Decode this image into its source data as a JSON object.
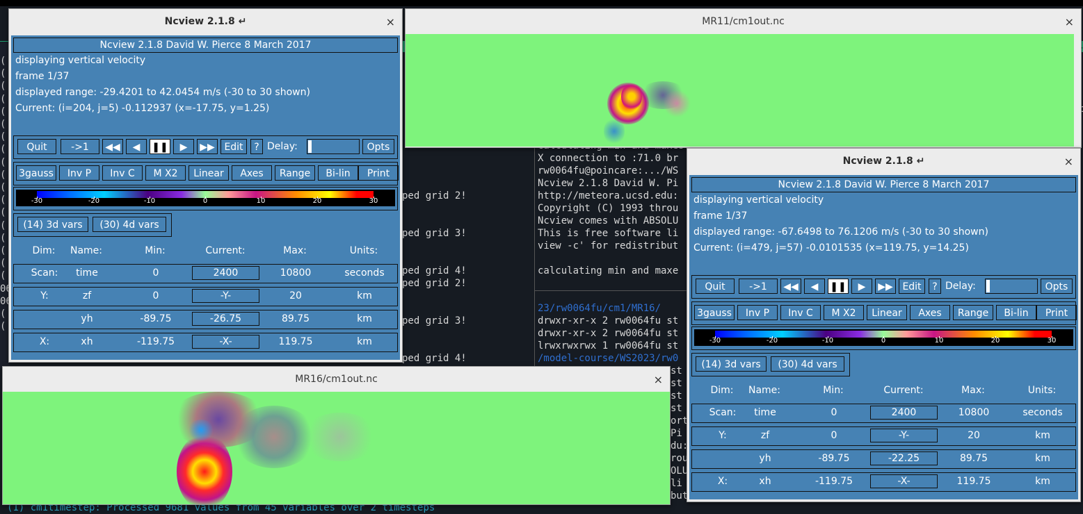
{
  "colorbar_ticks": [
    "-30",
    "-20",
    "-10",
    "0",
    "10",
    "20",
    "30"
  ],
  "terminal": {
    "left_lines": [
      {
        "text": "ped grid 2!"
      },
      {
        "text": "ped grid 3!"
      },
      {
        "text": "ped grid 4!"
      },
      {
        "text": "ped grid 2!"
      },
      {
        "text": "ped grid 3!"
      },
      {
        "text": "ped grid 4!"
      }
    ],
    "middle_top_lines": [
      "calculating min and maxes for w...",
      "X connection to :71.0 br",
      "rw0064fu@poincare:.../WS",
      "Ncview 2.1.8 David W. Pi",
      "http://meteora.ucsd.edu:",
      "Copyright (C) 1993 throu",
      "Ncview comes with ABSOLU",
      "This is free software li",
      "view -c' for redistribut",
      "",
      "calculating min and maxe"
    ],
    "middle_mid_lines": [
      "23/rw0064fu/cm1/MR16/",
      "drwxr-xr-x 2 rw0064fu st",
      "drwxr-xr-x 2 rw0064fu st",
      "lrwxrwxrwx 1 rw0064fu st",
      "/model-course/WS2023/rw0"
    ],
    "middle_bottom_lines": [
      "st",
      "st",
      "st",
      "st",
      "ort",
      "Pi",
      "du:",
      "rou",
      "OLU",
      "li",
      "but"
    ],
    "bottom_line": "(1) cm1timestep: Processed 9681 values from 45 variables over 2 timesteps",
    "left_edge_chars": [
      "(",
      "(",
      "(",
      "(",
      "(",
      "(",
      "(",
      "(",
      "(",
      "(",
      "(",
      "(",
      "(",
      "(",
      "(",
      "(",
      "(",
      "(",
      "06",
      "06",
      "(",
      "("
    ],
    "right_edge_chars": [
      "nc",
      "24"
    ]
  },
  "windows": [
    {
      "title": "Ncview 2.1.8 ↵",
      "close": "×",
      "header": "Ncview 2.1.8 David W. Pierce  8 March 2017",
      "info": [
        "displaying vertical velocity",
        "frame 1/37",
        "displayed range: -29.4201 to 42.0454 m/s (-30 to 30 shown)",
        "Current: (i=204, j=5) -0.112937 (x=-17.75, y=1.25)"
      ],
      "buttons1": [
        "Quit",
        "->1",
        "◀◀",
        "◀",
        "❚❚",
        "▶",
        "▶▶",
        "Edit",
        "?"
      ],
      "delay_label": "Delay:",
      "opts": "Opts",
      "buttons2": [
        "3gauss",
        "Inv P",
        "Inv C",
        "M X2",
        "Linear",
        "Axes",
        "Range",
        "Bi-lin",
        "Print"
      ],
      "vars": [
        "(14) 3d vars",
        "(30) 4d vars"
      ],
      "dim_header": [
        "Dim:",
        "Name:",
        "Min:",
        "Current:",
        "Max:",
        "Units:"
      ],
      "dims": [
        {
          "dim": "Scan:",
          "name": "time",
          "min": "0",
          "current": "2400",
          "max": "10800",
          "units": "seconds"
        },
        {
          "dim": "Y:",
          "name": "zf",
          "min": "0",
          "current": "-Y-",
          "max": "20",
          "units": "km"
        },
        {
          "dim": "",
          "name": "yh",
          "min": "-89.75",
          "current": "-26.75",
          "max": "89.75",
          "units": "km"
        },
        {
          "dim": "X:",
          "name": "xh",
          "min": "-119.75",
          "current": "-X-",
          "max": "119.75",
          "units": "km"
        }
      ]
    },
    {
      "title": "Ncview 2.1.8 ↵",
      "close": "×",
      "header": "Ncview 2.1.8 David W. Pierce  8 March 2017",
      "info": [
        "displaying vertical velocity",
        "frame 1/37",
        "displayed range: -67.6498 to 76.1206 m/s (-30 to 30 shown)",
        "Current: (i=479, j=57) -0.0101535 (x=119.75, y=14.25)"
      ],
      "buttons1": [
        "Quit",
        "->1",
        "◀◀",
        "◀",
        "❚❚",
        "▶",
        "▶▶",
        "Edit",
        "?"
      ],
      "delay_label": "Delay:",
      "opts": "Opts",
      "buttons2": [
        "3gauss",
        "Inv P",
        "Inv C",
        "M X2",
        "Linear",
        "Axes",
        "Range",
        "Bi-lin",
        "Print"
      ],
      "vars": [
        "(14) 3d vars",
        "(30) 4d vars"
      ],
      "dim_header": [
        "Dim:",
        "Name:",
        "Min:",
        "Current:",
        "Max:",
        "Units:"
      ],
      "dims": [
        {
          "dim": "Scan:",
          "name": "time",
          "min": "0",
          "current": "2400",
          "max": "10800",
          "units": "seconds"
        },
        {
          "dim": "Y:",
          "name": "zf",
          "min": "0",
          "current": "-Y-",
          "max": "20",
          "units": "km"
        },
        {
          "dim": "",
          "name": "yh",
          "min": "-89.75",
          "current": "-22.25",
          "max": "89.75",
          "units": "km"
        },
        {
          "dim": "X:",
          "name": "xh",
          "min": "-119.75",
          "current": "-X-",
          "max": "119.75",
          "units": "km"
        }
      ]
    }
  ],
  "plots": [
    {
      "title": "MR11/cm1out.nc",
      "close": "×"
    },
    {
      "title": "MR16/cm1out.nc",
      "close": "×"
    }
  ]
}
